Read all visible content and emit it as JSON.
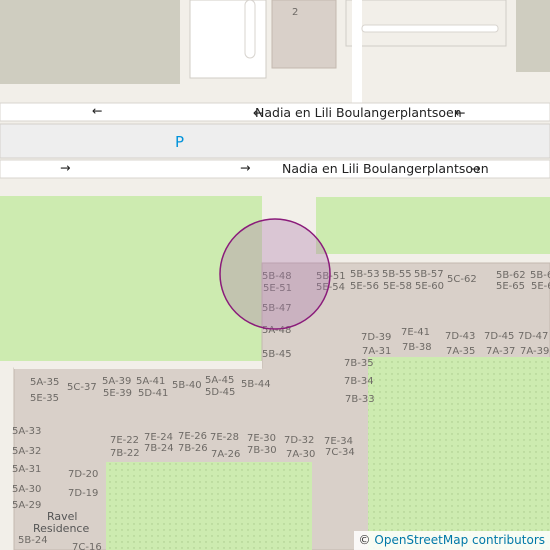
{
  "map": {
    "streets": [
      {
        "id": "street-top",
        "name": "Nadia en Lili Boulangerplantsoen"
      },
      {
        "id": "street-bottom",
        "name": "Nadia en Lili Boulangerplantsoen"
      }
    ],
    "parking_label": "P",
    "house_number": "2",
    "building_name": "Ravel Residence",
    "unit_labels": [
      "5B-48",
      "5E-51",
      "5B-51",
      "5E-54",
      "5B-53",
      "5E-56",
      "5B-55",
      "5E-58",
      "5B-57",
      "5E-60",
      "5C-62",
      "5B-62",
      "5E-65",
      "5B-6",
      "5E-6",
      "5B-47",
      "5A-48",
      "5B-45",
      "7D-39",
      "7A-31",
      "7E-41",
      "7B-38",
      "7D-43",
      "7A-35",
      "7D-45",
      "7A-37",
      "7D-47",
      "7A-39",
      "7B-35",
      "7B-34",
      "7B-33",
      "5A-35",
      "5E-35",
      "5C-37",
      "5A-39",
      "5E-39",
      "5A-41",
      "5D-41",
      "5B-40",
      "5A-45",
      "5D-45",
      "5B-44",
      "5A-33",
      "5A-32",
      "5A-31",
      "5A-30",
      "5A-29",
      "5B-24",
      "7E-22",
      "7B-22",
      "7E-24",
      "7B-24",
      "7E-26",
      "7B-26",
      "7E-28",
      "7A-26",
      "7E-30",
      "7B-30",
      "7D-32",
      "7A-30",
      "7E-34",
      "7C-34",
      "7D-20",
      "7D-19",
      "7C-16"
    ],
    "colors": {
      "background": "#f2efe9",
      "grass": "#cdebb0",
      "grass_dotted": "#c8e6a8",
      "building": "#d9d0c9",
      "building_block": "#d8cfc8",
      "road": "#ffffff",
      "parking": "#eeeeee",
      "parking_label": "#0092da",
      "location_circle_stroke": "#8a1b7a",
      "location_circle_fill": "#b07ab0"
    }
  },
  "attribution": {
    "copyright": "©",
    "link_text": "OpenStreetMap contributors"
  }
}
